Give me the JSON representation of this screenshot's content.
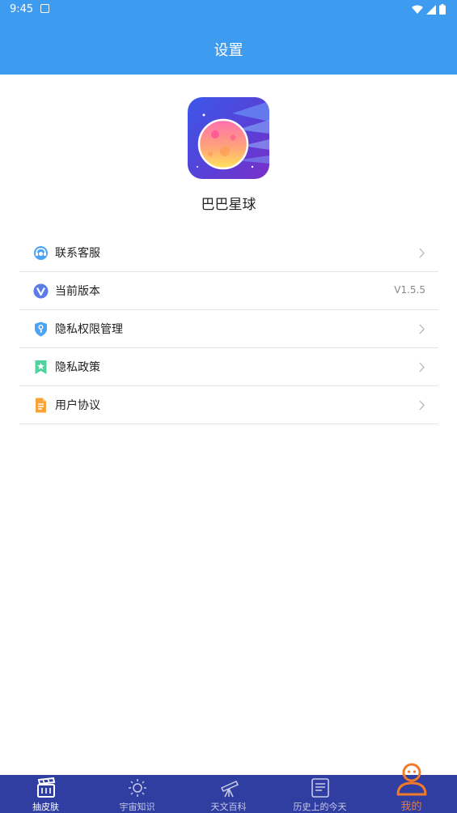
{
  "status_bar": {
    "time": "9:45"
  },
  "header": {
    "title": "设置"
  },
  "app": {
    "name": "巴巴星球"
  },
  "menu": {
    "items": [
      {
        "label": "联系客服",
        "value": "",
        "icon": "customer-service-icon",
        "has_chevron": true
      },
      {
        "label": "当前版本",
        "value": "V1.5.5",
        "icon": "version-icon",
        "has_chevron": false
      },
      {
        "label": "隐私权限管理",
        "value": "",
        "icon": "shield-key-icon",
        "has_chevron": true
      },
      {
        "label": "隐私政策",
        "value": "",
        "icon": "bookmark-star-icon",
        "has_chevron": true
      },
      {
        "label": "用户协议",
        "value": "",
        "icon": "document-icon",
        "has_chevron": true
      }
    ]
  },
  "tabs": [
    {
      "label": "抽皮肤",
      "icon": "clapperboard-icon",
      "state": "selected-white"
    },
    {
      "label": "宇宙知识",
      "icon": "sun-icon",
      "state": "normal"
    },
    {
      "label": "天文百科",
      "icon": "telescope-icon",
      "state": "normal"
    },
    {
      "label": "历史上的今天",
      "icon": "newspaper-icon",
      "state": "normal"
    },
    {
      "label": "我的",
      "icon": "user-icon",
      "state": "active"
    }
  ],
  "colors": {
    "header_bg": "#3d9cf0",
    "tab_bar_bg": "#2f3ea0",
    "tab_active": "#f07a2a",
    "divider": "#e4e4e4"
  }
}
